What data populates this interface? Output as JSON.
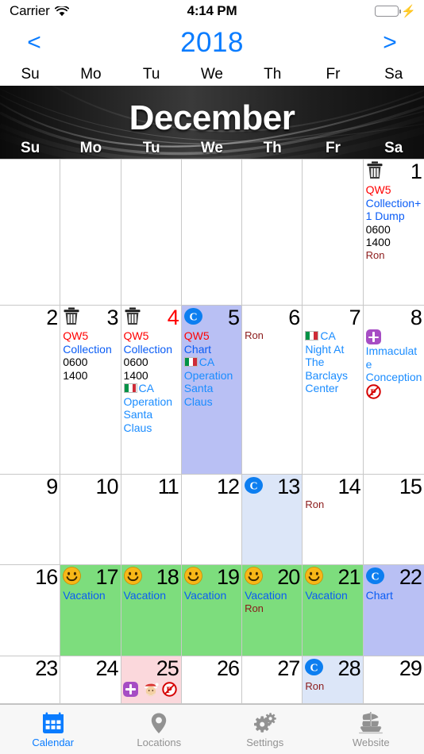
{
  "statusbar": {
    "carrier": "Carrier",
    "wifi_icon": "wifi-icon",
    "time": "4:14 PM",
    "battery_icon": "battery-full-icon",
    "charging_icon": "lightning-bolt-icon"
  },
  "yearbar": {
    "prev_label": "<",
    "year": "2018",
    "next_label": ">"
  },
  "weekdays": [
    "Su",
    "Mo",
    "Tu",
    "We",
    "Th",
    "Fr",
    "Sa"
  ],
  "month": {
    "name": "December"
  },
  "colors": {
    "accent_blue": "#0a7cff",
    "event_red": "#ff0000",
    "event_blue": "#0a5cf5",
    "person_maroon": "#8b1a1a",
    "selected_purple": "#b9c0f4",
    "today_blue": "#dce6f8",
    "vacation_green": "#7ddd7d",
    "holiday_pink": "#fbd8dc",
    "banner_black": "#050505",
    "grid_line": "#c8c8c8"
  },
  "weeks": [
    {
      "days": [
        {
          "num": "",
          "blank": true
        },
        {
          "num": "",
          "blank": true
        },
        {
          "num": "",
          "blank": true
        },
        {
          "num": "",
          "blank": true
        },
        {
          "num": "",
          "blank": true
        },
        {
          "num": "",
          "blank": true
        },
        {
          "num": "1",
          "icon": "trash-icon",
          "events": [
            {
              "text": "QW5",
              "style": "red"
            },
            {
              "text": "Collection+1 Dump",
              "style": "blue"
            },
            {
              "text": "0600",
              "style": "dark"
            },
            {
              "text": "1400",
              "style": "dark"
            },
            {
              "text": "Ron",
              "style": "maroon"
            }
          ]
        }
      ]
    },
    {
      "days": [
        {
          "num": "2"
        },
        {
          "num": "3",
          "icon": "trash-icon",
          "events": [
            {
              "text": "QW5",
              "style": "red"
            },
            {
              "text": "Collection",
              "style": "blue"
            },
            {
              "text": "0600",
              "style": "dark"
            },
            {
              "text": "1400",
              "style": "dark"
            }
          ]
        },
        {
          "num": "4",
          "num_style": "red",
          "icon": "trash-icon",
          "events": [
            {
              "text": "QW5",
              "style": "red"
            },
            {
              "text": "Collection",
              "style": "blue"
            },
            {
              "text": "0600",
              "style": "dark"
            },
            {
              "text": "1400",
              "style": "dark"
            },
            {
              "text": "CA Operation Santa Claus",
              "style": "brightblue",
              "icon": "italy-flag-icon"
            }
          ]
        },
        {
          "num": "5",
          "bg": "sel",
          "icon": "c-badge-icon",
          "events": [
            {
              "text": "QW5",
              "style": "red"
            },
            {
              "text": "Chart",
              "style": "blue"
            },
            {
              "text": "CA Operation Santa Claus",
              "style": "brightblue",
              "icon": "italy-flag-icon"
            }
          ]
        },
        {
          "num": "6",
          "events": [
            {
              "text": "Ron",
              "style": "maroon"
            }
          ]
        },
        {
          "num": "7",
          "events": [
            {
              "text": "CA Night At The Barclays Center",
              "style": "brightblue",
              "icon": "italy-flag-icon"
            }
          ]
        },
        {
          "num": "8",
          "events": [
            {
              "text": "Immaculate Conception",
              "style": "brightblue",
              "icon": "purple-cross-icon"
            },
            {
              "text": "",
              "style": "dark",
              "icon": "no-parking-icon"
            }
          ]
        }
      ]
    },
    {
      "days": [
        {
          "num": "9"
        },
        {
          "num": "10"
        },
        {
          "num": "11"
        },
        {
          "num": "12"
        },
        {
          "num": "13",
          "bg": "today",
          "icon": "c-badge-icon"
        },
        {
          "num": "14",
          "events": [
            {
              "text": "Ron",
              "style": "maroon"
            }
          ]
        },
        {
          "num": "15"
        }
      ]
    },
    {
      "days": [
        {
          "num": "16"
        },
        {
          "num": "17",
          "bg": "vac",
          "icon": "smiley-icon",
          "events": [
            {
              "text": "Vacation",
              "style": "blue"
            }
          ]
        },
        {
          "num": "18",
          "bg": "vac",
          "icon": "smiley-icon",
          "events": [
            {
              "text": "Vacation",
              "style": "blue"
            }
          ]
        },
        {
          "num": "19",
          "bg": "vac",
          "icon": "smiley-icon",
          "events": [
            {
              "text": "Vacation",
              "style": "blue"
            }
          ]
        },
        {
          "num": "20",
          "bg": "vac",
          "icon": "smiley-icon",
          "events": [
            {
              "text": "Vacation",
              "style": "blue"
            },
            {
              "text": "Ron",
              "style": "maroon"
            }
          ]
        },
        {
          "num": "21",
          "bg": "vac",
          "icon": "smiley-icon",
          "events": [
            {
              "text": "Vacation",
              "style": "blue"
            }
          ]
        },
        {
          "num": "22",
          "bg": "sel",
          "icon": "c-badge-icon",
          "events": [
            {
              "text": "Chart",
              "style": "blue"
            }
          ]
        }
      ]
    },
    {
      "days": [
        {
          "num": "23"
        },
        {
          "num": "24"
        },
        {
          "num": "25",
          "bg": "hol",
          "icon_row": [
            "purple-cross-icon",
            "santa-icon",
            "no-parking-icon"
          ]
        },
        {
          "num": "26"
        },
        {
          "num": "27"
        },
        {
          "num": "28",
          "bg": "today",
          "icon": "c-badge-icon",
          "events": [
            {
              "text": "Ron",
              "style": "maroon"
            }
          ]
        },
        {
          "num": "29"
        }
      ]
    }
  ],
  "tabbar": {
    "tabs": [
      {
        "label": "Calendar",
        "icon": "calendar-icon",
        "active": true
      },
      {
        "label": "Locations",
        "icon": "map-pin-icon",
        "active": false
      },
      {
        "label": "Settings",
        "icon": "gears-icon",
        "active": false
      },
      {
        "label": "Website",
        "icon": "ship-icon",
        "active": false
      }
    ]
  }
}
